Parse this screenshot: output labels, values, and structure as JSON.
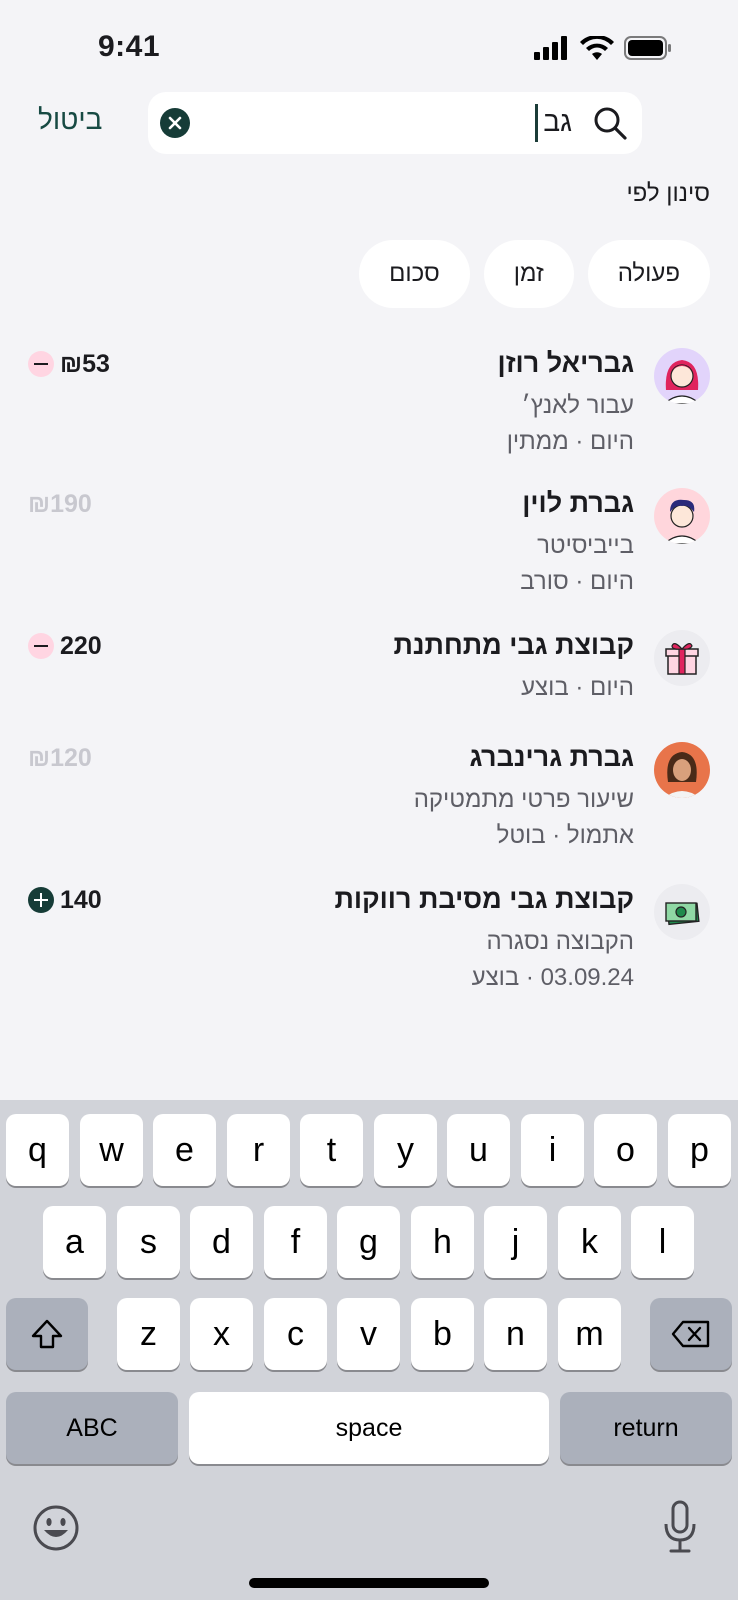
{
  "status": {
    "time": "9:41"
  },
  "search": {
    "query": "גב",
    "cancel_label": "ביטול"
  },
  "filter": {
    "label": "סינון לפי",
    "chips": [
      "פעולה",
      "זמן",
      "סכום"
    ]
  },
  "transactions": [
    {
      "title": "גבריאל רוזן",
      "subtitle": "עבור לאנץ׳",
      "meta": "היום · ממתין",
      "amount": "₪53",
      "sign": "minus",
      "avatar": "woman-red-hair-avatar"
    },
    {
      "title": "גברת לוין",
      "subtitle": "בייביסיטר",
      "meta": "היום · סורב",
      "amount": "₪190",
      "sign": "",
      "avatar": "man-dark-hair-avatar"
    },
    {
      "title": "קבוצת גבי מתחתנת",
      "subtitle": "",
      "meta": "היום · בוצע",
      "amount": "220",
      "sign": "minus",
      "avatar": "gift-icon"
    },
    {
      "title": "גברת גרינברג",
      "subtitle": "שיעור פרטי מתמטיקה",
      "meta": "אתמול · בוטל",
      "amount": "₪120",
      "sign": "",
      "avatar": "woman-photo-avatar"
    },
    {
      "title": "קבוצת גבי מסיבת רווקות",
      "subtitle": "הקבוצה נסגרה",
      "meta": "03.09.24 · בוצע",
      "amount": "140",
      "sign": "plus",
      "avatar": "money-icon"
    }
  ],
  "keyboard": {
    "row1": [
      "q",
      "w",
      "e",
      "r",
      "t",
      "y",
      "u",
      "i",
      "o",
      "p"
    ],
    "row2": [
      "a",
      "s",
      "d",
      "f",
      "g",
      "h",
      "j",
      "k",
      "l"
    ],
    "row3": [
      "z",
      "x",
      "c",
      "v",
      "b",
      "n",
      "m"
    ],
    "abc": "ABC",
    "space": "space",
    "return": "return"
  },
  "colors": {
    "accent": "#163c37",
    "minus_badge": "#ffd5e2",
    "background": "#f4f4f7"
  }
}
